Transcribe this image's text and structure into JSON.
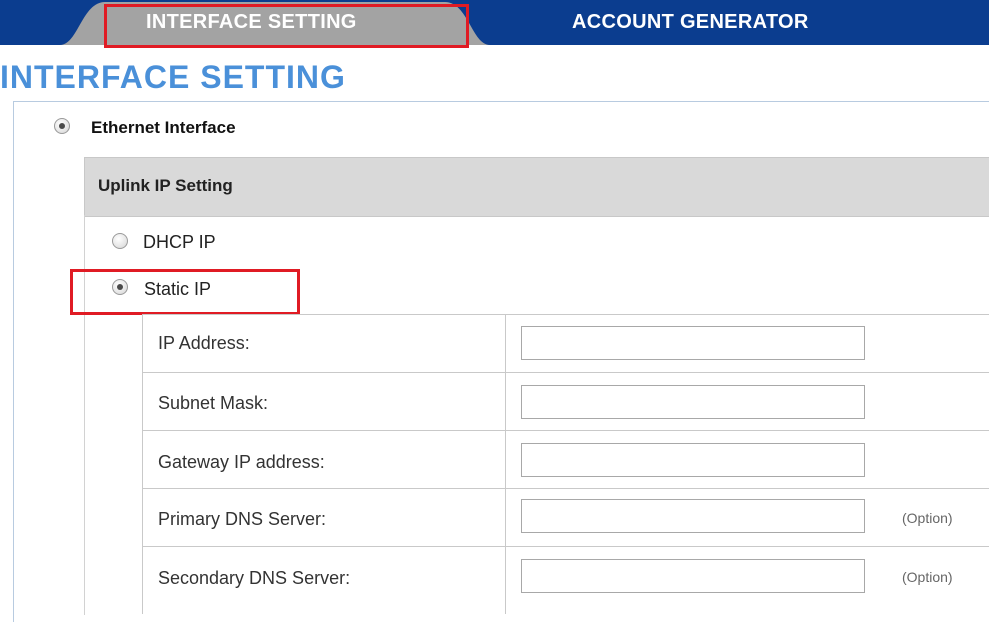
{
  "tabs": {
    "interface_setting": "INTERFACE SETTING",
    "account_generator": "ACCOUNT GENERATOR"
  },
  "page_title": "INTERFACE SETTING",
  "ethernet": {
    "label": "Ethernet Interface",
    "selected": true
  },
  "uplink": {
    "header": "Uplink IP Setting",
    "options": [
      {
        "label": "DHCP IP",
        "selected": false
      },
      {
        "label": "Static IP",
        "selected": true
      }
    ]
  },
  "static_fields": [
    {
      "label": "IP Address:",
      "value": "",
      "note": ""
    },
    {
      "label": "Subnet Mask:",
      "value": "",
      "note": ""
    },
    {
      "label": "Gateway IP address:",
      "value": "",
      "note": ""
    },
    {
      "label": "Primary DNS Server:",
      "value": "",
      "note": "(Option)"
    },
    {
      "label": "Secondary DNS Server:",
      "value": "",
      "note": "(Option)"
    }
  ],
  "colors": {
    "nav_bar": "#0b3d8f",
    "active_tab": "#a3a3a3",
    "title_blue": "#4a90d9",
    "highlight_red": "#e01b24"
  }
}
